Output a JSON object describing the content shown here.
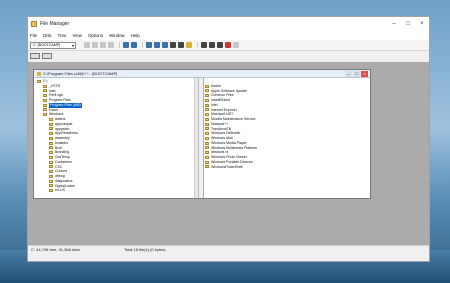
{
  "window": {
    "title": "File Manager",
    "controls": [
      "–",
      "□",
      "×"
    ]
  },
  "menu": [
    "File",
    "Disk",
    "Tree",
    "View",
    "Options",
    "Window",
    "Help"
  ],
  "toolbar": {
    "drive": "C: [BOOTCAMP]"
  },
  "child": {
    "title": "C:\\Program Files (x86)\\*.* - [BOOTCAMP]",
    "controls": [
      "–",
      "□",
      "×"
    ]
  },
  "tree": {
    "items": [
      {
        "label": "C:\\",
        "indent": 0
      },
      {
        "label": "_NTFS",
        "indent": 1
      },
      {
        "label": "intel",
        "indent": 1
      },
      {
        "label": "PerfLogs",
        "indent": 1
      },
      {
        "label": "Program Files",
        "indent": 1
      },
      {
        "label": "Program Files (x86)",
        "indent": 1,
        "selected": true
      },
      {
        "label": "Users",
        "indent": 1
      },
      {
        "label": "Windows",
        "indent": 1
      },
      {
        "label": "addins",
        "indent": 2
      },
      {
        "label": "appcompat",
        "indent": 2
      },
      {
        "label": "apppatch",
        "indent": 2
      },
      {
        "label": "AppReadiness",
        "indent": 2
      },
      {
        "label": "assembly",
        "indent": 2
      },
      {
        "label": "bcastdvr",
        "indent": 2
      },
      {
        "label": "Boot",
        "indent": 2
      },
      {
        "label": "Branding",
        "indent": 2
      },
      {
        "label": "CbsTemp",
        "indent": 2
      },
      {
        "label": "Containers",
        "indent": 2
      },
      {
        "label": "CSC",
        "indent": 2
      },
      {
        "label": "Cursors",
        "indent": 2
      },
      {
        "label": "debug",
        "indent": 2
      },
      {
        "label": "diagnostics",
        "indent": 2
      },
      {
        "label": "DigitalLocker",
        "indent": 2
      },
      {
        "label": "en-US",
        "indent": 2
      }
    ]
  },
  "files": [
    {
      "label": "..",
      "up": true
    },
    {
      "label": "Adobe"
    },
    {
      "label": "Apple Software Update"
    },
    {
      "label": "Common Files"
    },
    {
      "label": "InstallShield"
    },
    {
      "label": "Intel"
    },
    {
      "label": "Internet Explorer"
    },
    {
      "label": "Microsoft.NET"
    },
    {
      "label": "Mozilla Maintenance Service"
    },
    {
      "label": "Notepad++"
    },
    {
      "label": "TransbootTB"
    },
    {
      "label": "Windows Defender"
    },
    {
      "label": "Windows Mail"
    },
    {
      "label": "Windows Media Player"
    },
    {
      "label": "Windows Multimedia Platform"
    },
    {
      "label": "windows nt"
    },
    {
      "label": "Windows Photo Viewer"
    },
    {
      "label": "Windows Portable Devices"
    },
    {
      "label": "WindowsPowerShell"
    }
  ],
  "status": {
    "left": "C: 44,708 free, 91,368 total",
    "right": "Total 18 file(s) (0 bytes)"
  }
}
